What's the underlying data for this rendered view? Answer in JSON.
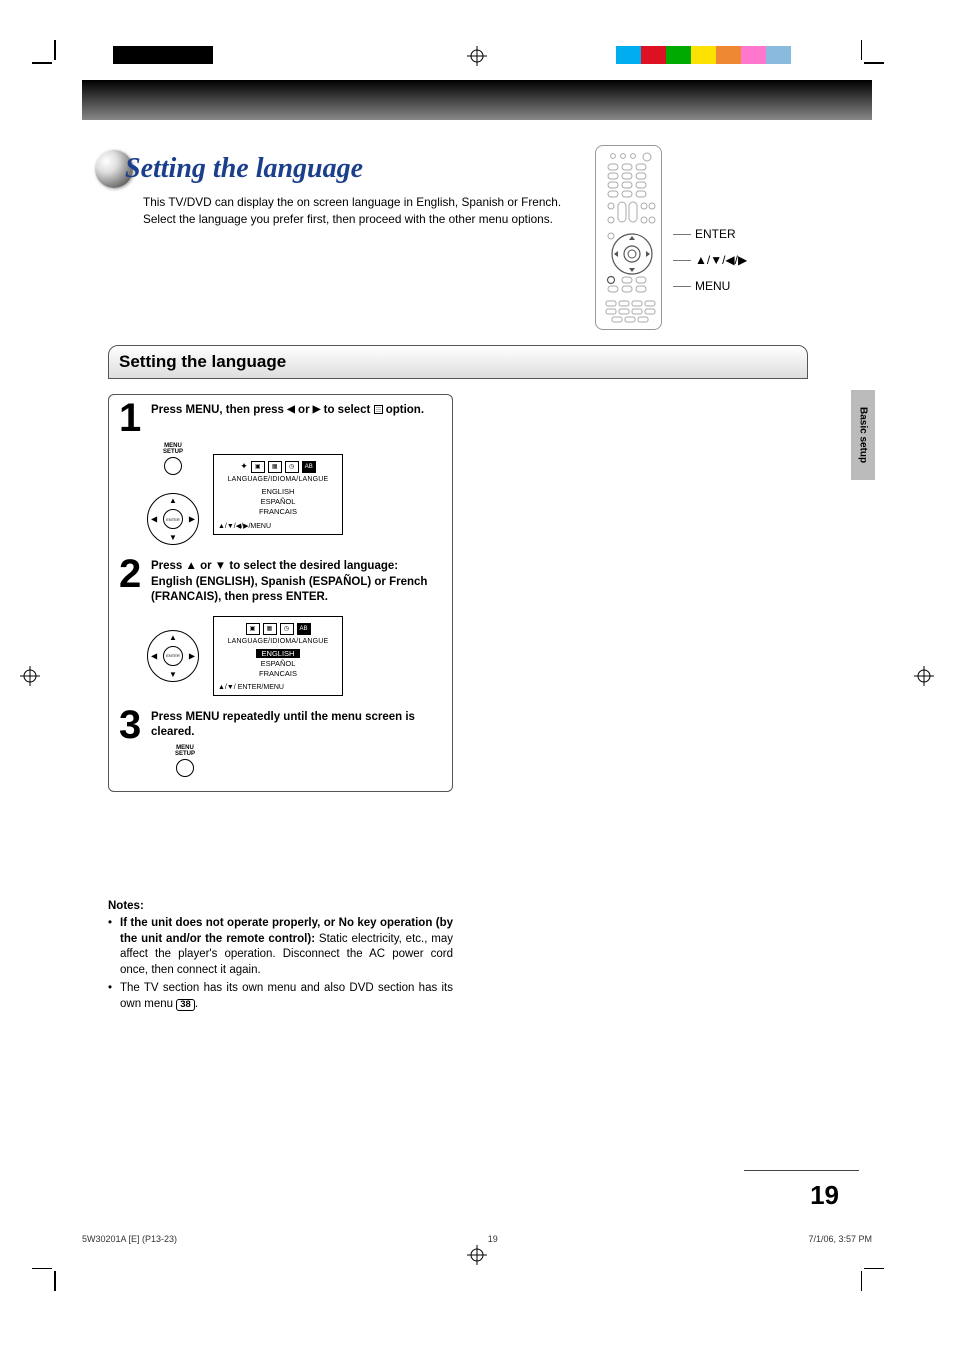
{
  "header": {
    "title": "Setting the language",
    "description": "This TV/DVD can display the on screen language in English, Spanish or French. Select the language you prefer first, then proceed with the other menu options."
  },
  "remote_callouts": {
    "enter": "ENTER",
    "arrows": "▲/▼/◀/▶",
    "menu": "MENU"
  },
  "section": {
    "title": "Setting the language"
  },
  "steps": [
    {
      "num": "1",
      "text_pre": "Press MENU, then press ",
      "text_mid": " or ",
      "text_post": " to select ",
      "text_end": " option.",
      "arrow_left": "◀",
      "arrow_right": "▶",
      "button_label": "MENU\nSETUP",
      "dpad_center": "ENTER",
      "screen": {
        "menu_label": "LANGUAGE/IDIOMA/LANGUE",
        "items": [
          "ENGLISH",
          "ESPAÑOL",
          "FRANCAIS"
        ],
        "footer": "▲/▼/◀/▶/MENU",
        "selected_index": -1
      }
    },
    {
      "num": "2",
      "text": "Press ▲ or ▼ to select the desired language: English (ENGLISH), Spanish (ESPAÑOL) or French (FRANCAIS), then press ENTER.",
      "dpad_center": "ENTER",
      "screen": {
        "menu_label": "LANGUAGE/IDIOMA/LANGUE",
        "items": [
          "ENGLISH",
          "ESPAÑOL",
          "FRANCAIS"
        ],
        "footer": "▲/▼/ ENTER/MENU",
        "selected_index": 0
      }
    },
    {
      "num": "3",
      "text": "Press MENU repeatedly until the menu screen is cleared.",
      "button_label": "MENU\nSETUP"
    }
  ],
  "notes": {
    "title": "Notes:",
    "items": [
      {
        "bold": "If the unit does not operate properly, or No key operation (by the unit and/or the remote control):",
        "rest": " Static electricity, etc., may affect the player's operation. Disconnect the AC power cord once, then connect it again."
      },
      {
        "bold": "",
        "rest": "The TV section has its own menu and also DVD section has its own menu ",
        "ref": "38",
        "tail": "."
      }
    ]
  },
  "side_tab": "Basic setup",
  "page_number": "19",
  "footer": {
    "left": "5W30201A [E] (P13-23)",
    "center": "19",
    "right": "7/1/06, 3:57 PM"
  },
  "chips_left": [
    "#000",
    "#000",
    "#000",
    "#000",
    "#fff",
    "#fff",
    "#fff",
    "#fff"
  ],
  "chips_right": [
    "#fff",
    "#00aeef",
    "#d12",
    "#0a0",
    "#fde100",
    "#e83",
    "#f7c",
    "#8bd"
  ]
}
